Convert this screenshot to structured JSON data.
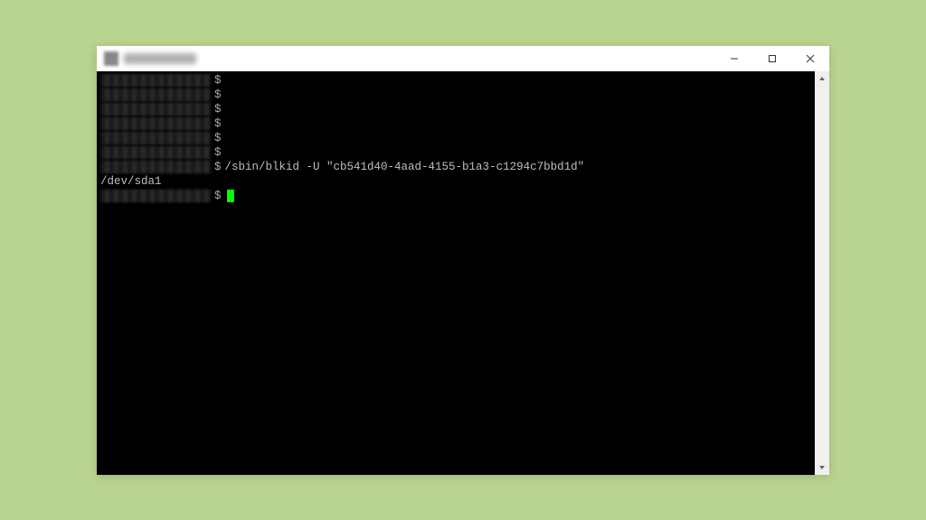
{
  "titlebar": {
    "title_redacted": true
  },
  "terminal": {
    "prompt_symbol": "$",
    "lines": [
      {
        "redacted_host": true,
        "prompt": "$",
        "text": ""
      },
      {
        "redacted_host": true,
        "prompt": "$",
        "text": ""
      },
      {
        "redacted_host": true,
        "prompt": "$",
        "text": ""
      },
      {
        "redacted_host": true,
        "prompt": "$",
        "text": ""
      },
      {
        "redacted_host": true,
        "prompt": "$",
        "text": ""
      },
      {
        "redacted_host": true,
        "prompt": "$",
        "text": ""
      },
      {
        "redacted_host": true,
        "prompt": "$",
        "text": "/sbin/blkid -U \"cb541d40-4aad-4155-b1a3-c1294c7bbd1d\""
      }
    ],
    "output": "/dev/sda1",
    "current_prompt": {
      "redacted_host": true,
      "prompt": "$",
      "cursor": true
    }
  }
}
